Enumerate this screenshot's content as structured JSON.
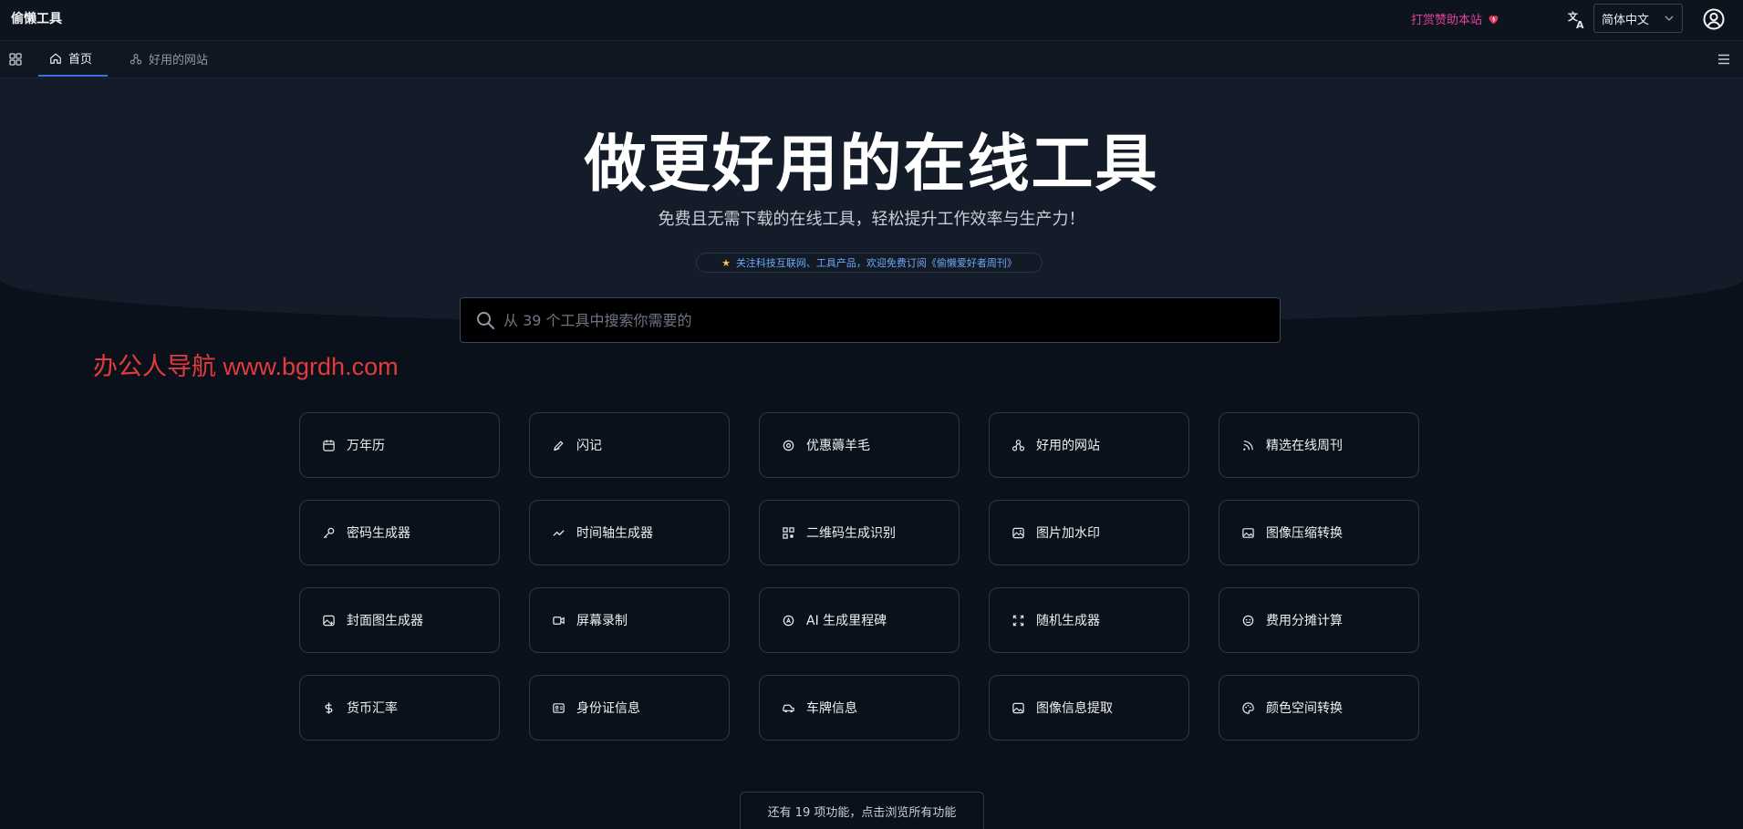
{
  "header": {
    "brand": "偷懒工具",
    "donate_label": "打赏赞助本站",
    "language": "简体中文"
  },
  "nav": {
    "tabs": [
      {
        "label": "首页",
        "active": true
      },
      {
        "label": "好用的网站",
        "active": false
      }
    ]
  },
  "hero": {
    "title": "做更好用的在线工具",
    "subtitle": "免费且无需下载的在线工具，轻松提升工作效率与生产力！",
    "promo": "关注科技互联网、工具产品，欢迎免费订阅《偷懒爱好者周刊》"
  },
  "search": {
    "placeholder": "从 39 个工具中搜索你需要的",
    "value": ""
  },
  "watermark": "办公人导航  www.bgrdh.com",
  "tools": [
    {
      "label": "万年历",
      "icon": "calendar-icon"
    },
    {
      "label": "闪记",
      "icon": "note-icon"
    },
    {
      "label": "优惠薅羊毛",
      "icon": "coupon-icon"
    },
    {
      "label": "好用的网站",
      "icon": "sites-icon"
    },
    {
      "label": "精选在线周刊",
      "icon": "rss-icon"
    },
    {
      "label": "密码生成器",
      "icon": "key-icon"
    },
    {
      "label": "时间轴生成器",
      "icon": "timeline-icon"
    },
    {
      "label": "二维码生成识别",
      "icon": "qrcode-icon"
    },
    {
      "label": "图片加水印",
      "icon": "image-watermark-icon"
    },
    {
      "label": "图像压缩转换",
      "icon": "image-compress-icon"
    },
    {
      "label": "封面图生成器",
      "icon": "cover-image-icon"
    },
    {
      "label": "屏幕录制",
      "icon": "video-icon"
    },
    {
      "label": "AI 生成里程碑",
      "icon": "ai-icon"
    },
    {
      "label": "随机生成器",
      "icon": "shuffle-icon"
    },
    {
      "label": "费用分摊计算",
      "icon": "split-cost-icon"
    },
    {
      "label": "货币汇率",
      "icon": "dollar-icon"
    },
    {
      "label": "身份证信息",
      "icon": "id-card-icon"
    },
    {
      "label": "车牌信息",
      "icon": "car-icon"
    },
    {
      "label": "图像信息提取",
      "icon": "image-info-icon"
    },
    {
      "label": "颜色空间转换",
      "icon": "palette-icon"
    }
  ],
  "more_label": "还有 19 项功能，点击浏览所有功能",
  "colors": {
    "background": "#0b111b",
    "hero": "#131c28",
    "accent": "#3f6fe0",
    "donate": "#e2429b",
    "promo": "#6fa7f5",
    "watermark": "#e33b3b"
  }
}
